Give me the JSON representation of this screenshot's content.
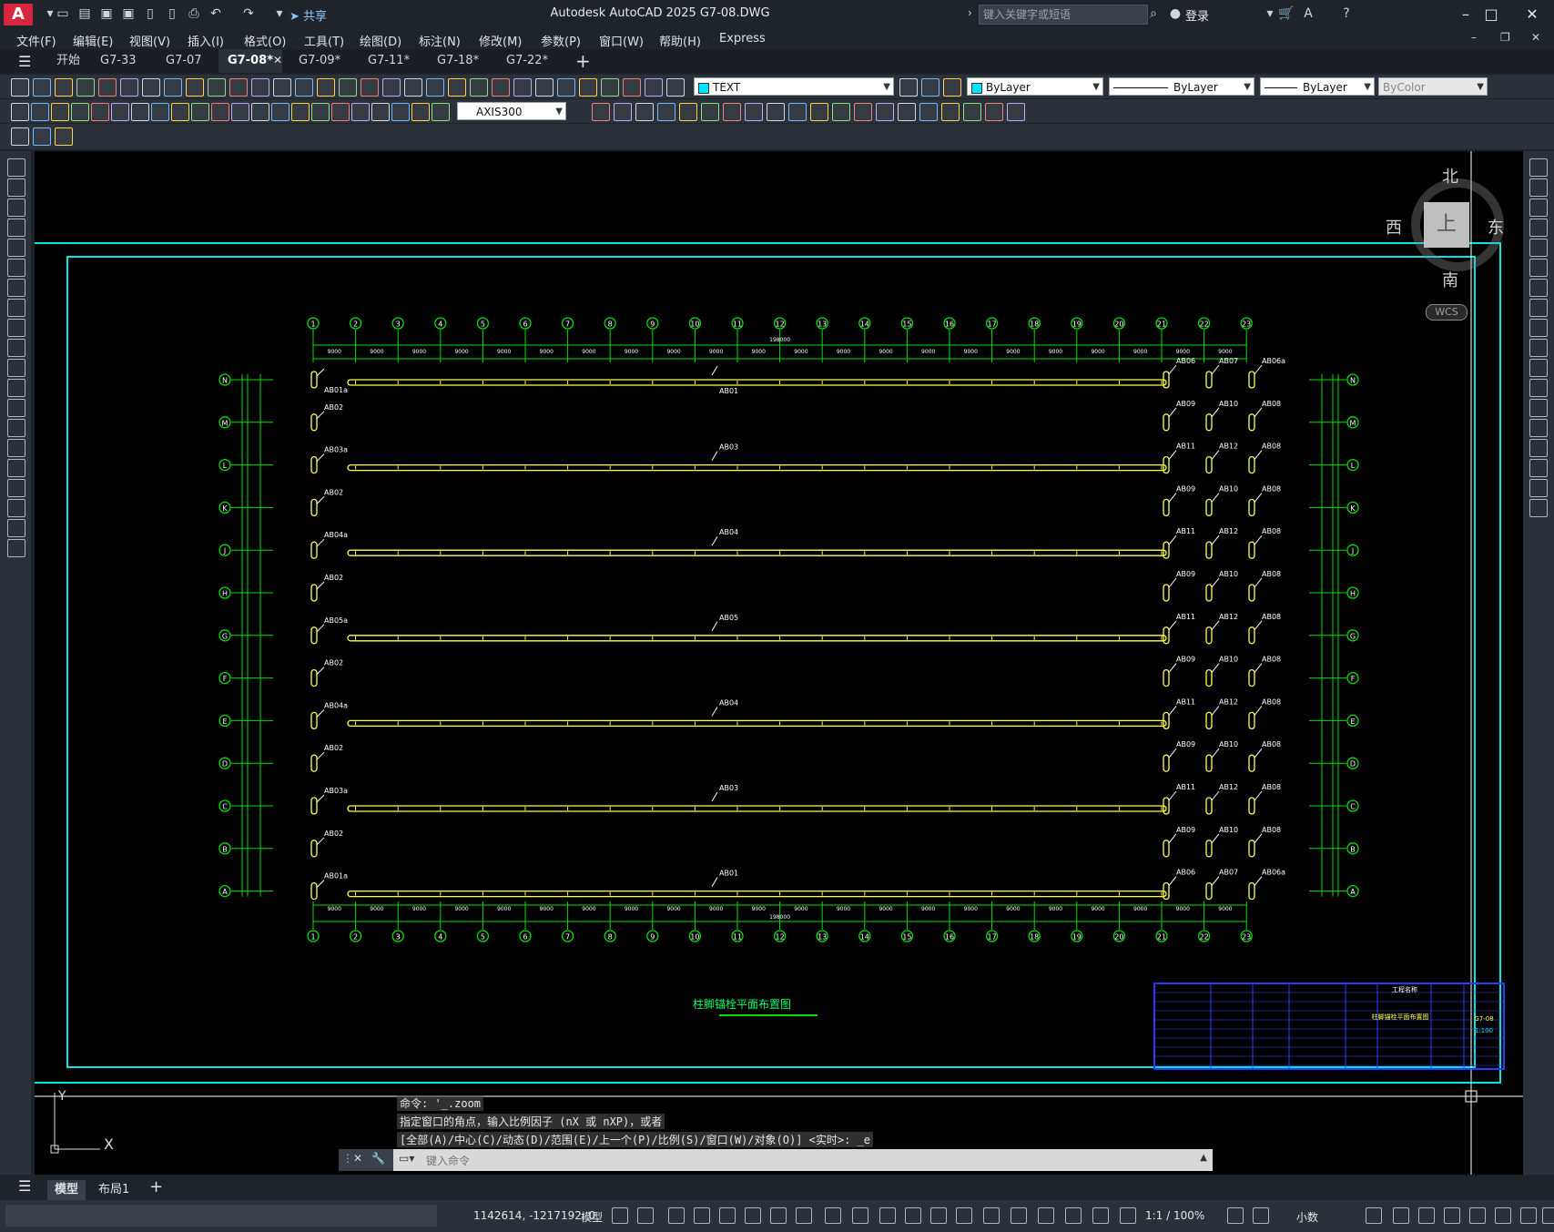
{
  "app": {
    "logo": "A",
    "title": "Autodesk AutoCAD 2025    G7-08.DWG",
    "share": "共享",
    "search_placeholder": "键入关键字或短语",
    "login": "登录"
  },
  "menu": [
    "文件(F)",
    "编辑(E)",
    "视图(V)",
    "插入(I)",
    "格式(O)",
    "工具(T)",
    "绘图(D)",
    "标注(N)",
    "修改(M)",
    "参数(P)",
    "窗口(W)",
    "帮助(H)",
    "Express"
  ],
  "tabs": [
    "开始",
    "G7-33",
    "G7-07",
    "G7-08*",
    "G7-09*",
    "G7-11*",
    "G7-18*",
    "G7-22*"
  ],
  "active_tab": "G7-08*",
  "toolbar": {
    "layer": "TEXT",
    "color": "ByLayer",
    "linetype": "ByLayer",
    "lineweight": "ByLayer",
    "plotstyle": "ByColor",
    "dimstyle": "AXIS300"
  },
  "viewcube": {
    "north": "北",
    "south": "南",
    "east": "东",
    "west": "西",
    "top": "上",
    "wcs": "WCS"
  },
  "drawing": {
    "col_labels": [
      "1",
      "2",
      "3",
      "4",
      "5",
      "6",
      "7",
      "8",
      "9",
      "10",
      "11",
      "12",
      "13",
      "14",
      "15",
      "16",
      "17",
      "18",
      "19",
      "20",
      "21",
      "22",
      "23"
    ],
    "row_labels": [
      "N",
      "M",
      "L",
      "K",
      "J",
      "H",
      "G",
      "F",
      "E",
      "D",
      "C",
      "B",
      "A"
    ],
    "span_label": "9000",
    "total_label": "198000",
    "beam_labels": [
      "AB01",
      "AB03",
      "AB04",
      "AB05",
      "AB04",
      "AB03",
      "AB01"
    ],
    "left_labels": [
      "AB01a",
      "AB02",
      "AB03a",
      "AB02",
      "AB04a",
      "AB02",
      "AB05a",
      "AB02",
      "AB04a",
      "AB02",
      "AB03a",
      "AB02",
      "AB01a"
    ],
    "right_grid": [
      [
        "AB06",
        "AB07",
        "AB06a"
      ],
      [
        "AB09",
        "AB10",
        "AB08"
      ],
      [
        "AB11",
        "AB12",
        "AB08"
      ],
      [
        "AB09",
        "AB10",
        "AB08"
      ],
      [
        "AB11",
        "AB12",
        "AB08"
      ],
      [
        "AB09",
        "AB10",
        "AB08"
      ],
      [
        "AB11",
        "AB12",
        "AB08"
      ],
      [
        "AB09",
        "AB10",
        "AB08"
      ],
      [
        "AB11",
        "AB12",
        "AB08"
      ],
      [
        "AB09",
        "AB10",
        "AB08"
      ],
      [
        "AB11",
        "AB12",
        "AB08"
      ],
      [
        "AB09",
        "AB10",
        "AB08"
      ],
      [
        "AB06",
        "AB07",
        "AB06a"
      ]
    ],
    "drawing_title": "柱脚锚栓平面布置图",
    "titleblock": {
      "project": "工程名称",
      "drawing_name": "柱脚锚栓平面布置图",
      "number": "G7-08",
      "scale": "1:100"
    }
  },
  "command": {
    "history": [
      "命令: '_.zoom",
      "指定窗口的角点，输入比例因子 (nX 或 nXP)，或者",
      "[全部(A)/中心(C)/动态(D)/范围(E)/上一个(P)/比例(S)/窗口(W)/对象(O)] <实时>: _e"
    ],
    "placeholder": "键入命令"
  },
  "status": {
    "model_tab": "模型",
    "layout_tab": "布局1",
    "coords": "1142614, -1217192, 0",
    "mode": "模型",
    "scale": "1:1 / 100%",
    "units": "小数"
  }
}
